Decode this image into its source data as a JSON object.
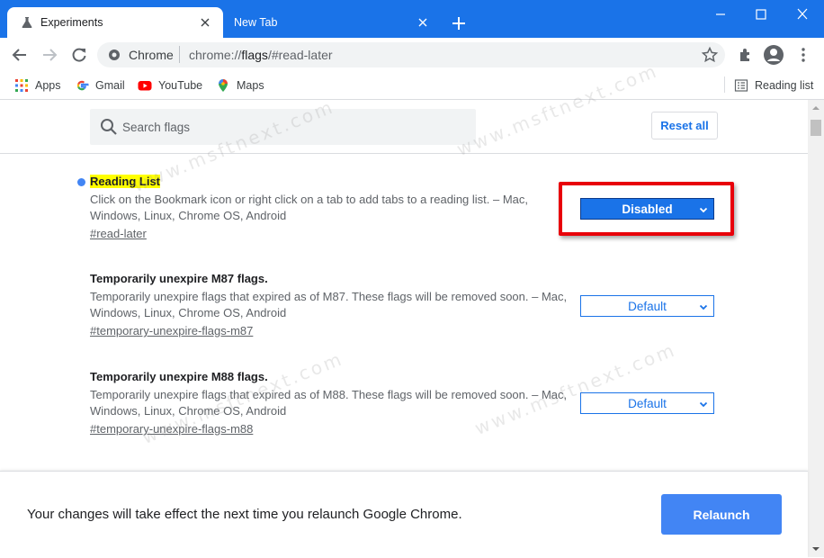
{
  "tabs": [
    {
      "title": "Experiments",
      "icon": "flask-icon",
      "active": true
    },
    {
      "title": "New Tab",
      "active": false
    }
  ],
  "toolbar": {
    "omnibox_chrome": "Chrome",
    "url_scheme": "chrome://",
    "url_host": "flags",
    "url_path": "/#read-later"
  },
  "bookmarks": {
    "items": [
      {
        "label": "Apps",
        "icon": "apps-grid-icon"
      },
      {
        "label": "Gmail",
        "icon": "google-g-icon"
      },
      {
        "label": "YouTube",
        "icon": "youtube-icon"
      },
      {
        "label": "Maps",
        "icon": "maps-pin-icon"
      }
    ],
    "reading_list": "Reading list"
  },
  "search": {
    "placeholder": "Search flags",
    "value": ""
  },
  "reset_all": "Reset all",
  "flags": [
    {
      "name": "Reading List",
      "description": "Click on the Bookmark icon or right click on a tab to add tabs to a reading list. – Mac, Windows, Linux, Chrome OS, Android",
      "link": "#read-later",
      "state": "Disabled"
    },
    {
      "name": "Temporarily unexpire M87 flags.",
      "description": "Temporarily unexpire flags that expired as of M87. These flags will be removed soon. – Mac, Windows, Linux, Chrome OS, Android",
      "link": "#temporary-unexpire-flags-m87",
      "state": "Default"
    },
    {
      "name": "Temporarily unexpire M88 flags.",
      "description": "Temporarily unexpire flags that expired as of M88. These flags will be removed soon. – Mac, Windows, Linux, Chrome OS, Android",
      "link": "#temporary-unexpire-flags-m88",
      "state": "Default"
    }
  ],
  "footer": {
    "message": "Your changes will take effect the next time you relaunch Google Chrome.",
    "relaunch": "Relaunch"
  },
  "colors": {
    "accent": "#1a73e8",
    "highlight": "#ffff00",
    "annotation": "#e8000a",
    "relaunch": "#4285f4"
  },
  "watermark": "www.msftnext.com"
}
